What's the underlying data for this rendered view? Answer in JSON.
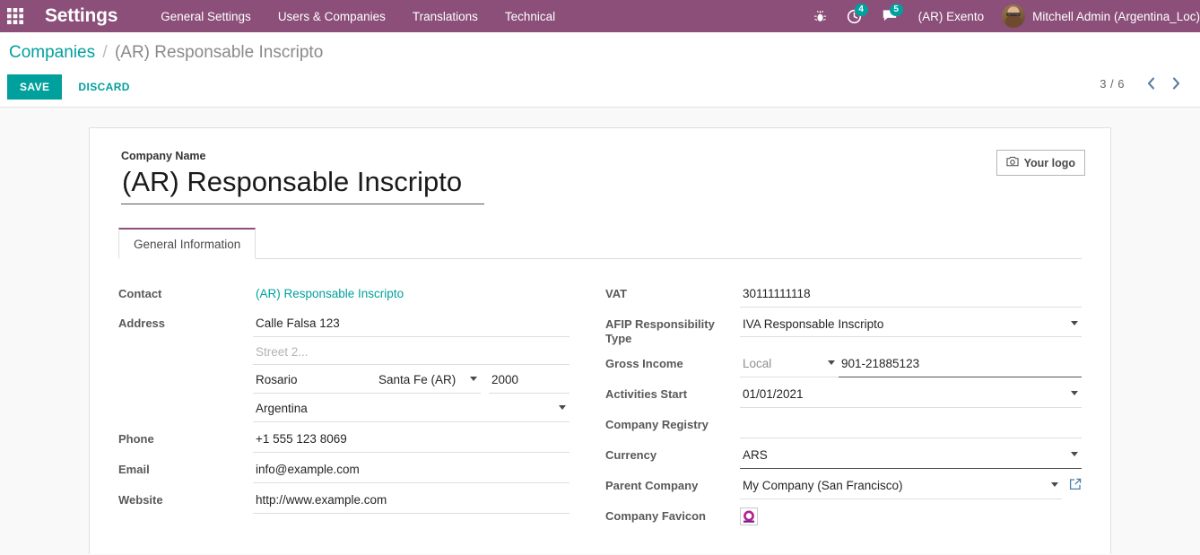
{
  "navbar": {
    "apps_icon": "apps-grid-icon",
    "brand": "Settings",
    "menu": [
      {
        "label": "General Settings"
      },
      {
        "label": "Users & Companies"
      },
      {
        "label": "Translations"
      },
      {
        "label": "Technical"
      }
    ],
    "right": {
      "debug_icon": "bug-icon",
      "activities_icon": "clock-icon",
      "activities_count": "4",
      "messages_icon": "chat-icon",
      "messages_count": "5",
      "company": "(AR) Exento",
      "avatar": "user-avatar",
      "user_name": "Mitchell Admin (Argentina_Loc)"
    }
  },
  "control_panel": {
    "breadcrumb_root": "Companies",
    "breadcrumb_sep": "/",
    "breadcrumb_current": "(AR) Responsable Inscripto",
    "save_label": "SAVE",
    "discard_label": "DISCARD",
    "pager_count": "3 / 6",
    "prev_icon": "chevron-left-icon",
    "next_icon": "chevron-right-icon"
  },
  "sheet": {
    "logo_button": {
      "icon": "camera-icon",
      "label": "Your logo"
    },
    "company_name_label": "Company Name",
    "company_name_value": "(AR) Responsable Inscripto",
    "tabs": [
      {
        "label": "General Information",
        "active": true
      }
    ],
    "left_column": {
      "contact": {
        "label": "Contact",
        "value": "(AR) Responsable Inscripto"
      },
      "address": {
        "label": "Address",
        "street": "Calle Falsa 123",
        "street2_placeholder": "Street 2...",
        "street2": "",
        "city": "Rosario",
        "state": "Santa Fe (AR)",
        "zip": "2000",
        "country": "Argentina"
      },
      "phone": {
        "label": "Phone",
        "value": "+1 555 123 8069"
      },
      "email": {
        "label": "Email",
        "value": "info@example.com"
      },
      "website": {
        "label": "Website",
        "value": "http://www.example.com"
      }
    },
    "right_column": {
      "vat": {
        "label": "VAT",
        "value": "30111111118"
      },
      "afip": {
        "label": "AFIP Responsibility Type",
        "value": "IVA Responsable Inscripto"
      },
      "gross_income": {
        "label": "Gross Income",
        "type_value": "Local",
        "number": "901-21885123"
      },
      "activities_start": {
        "label": "Activities Start",
        "value": "01/01/2021"
      },
      "company_registry": {
        "label": "Company Registry",
        "value": ""
      },
      "currency": {
        "label": "Currency",
        "value": "ARS"
      },
      "parent_company": {
        "label": "Parent Company",
        "value": "My Company (San Francisco)",
        "external_link_icon": "external-link-icon"
      },
      "favicon": {
        "label": "Company Favicon",
        "icon": "odoo-favicon-icon"
      }
    }
  },
  "colors": {
    "brand_purple": "#8b4f79",
    "accent_teal": "#00a09d",
    "favicon_magenta": "#b5218f"
  }
}
